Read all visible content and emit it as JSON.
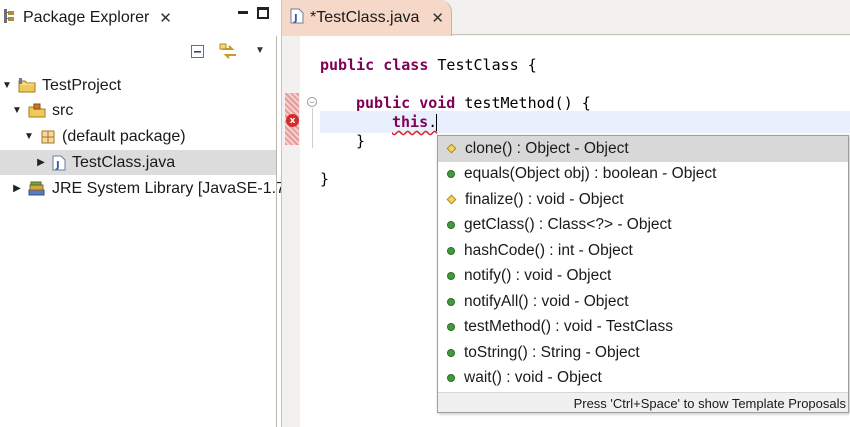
{
  "package_explorer": {
    "title": "Package Explorer",
    "close_glyph": "✕",
    "tree": {
      "project": {
        "label": "TestProject",
        "icon": "project-folder-icon"
      },
      "src": {
        "label": "src",
        "icon": "source-folder-icon"
      },
      "package": {
        "label": "(default package)",
        "icon": "package-icon"
      },
      "file": {
        "label": "TestClass.java",
        "icon": "java-file-icon",
        "selected": true
      },
      "jre": {
        "label": "JRE System Library [JavaSE-1.7",
        "icon": "library-icon"
      }
    }
  },
  "editor": {
    "tab_title": "*TestClass.java",
    "close_glyph": "✕",
    "code": {
      "line1_kw1": "public",
      "line1_kw2": "class",
      "line1_rest": " TestClass {",
      "line2_kw1": "public",
      "line2_kw2": "void",
      "line2_rest": " testMethod() {",
      "line3_kw": "this",
      "line3_rest": ".",
      "line4": "}",
      "line5": "}"
    },
    "error_glyph": "x"
  },
  "content_assist": {
    "proposals": [
      {
        "label": "clone() : Object - Object",
        "icon": "protected-method-icon",
        "selected": true
      },
      {
        "label": "equals(Object obj) : boolean - Object",
        "icon": "public-method-icon"
      },
      {
        "label": "finalize() : void - Object",
        "icon": "protected-method-icon"
      },
      {
        "label": "getClass() : Class<?> - Object",
        "icon": "public-method-icon"
      },
      {
        "label": "hashCode() : int - Object",
        "icon": "public-method-icon"
      },
      {
        "label": "notify() : void - Object",
        "icon": "public-method-icon"
      },
      {
        "label": "notifyAll() : void - Object",
        "icon": "public-method-icon"
      },
      {
        "label": "testMethod() : void - TestClass",
        "icon": "public-method-icon"
      },
      {
        "label": "toString() : String - Object",
        "icon": "public-method-icon"
      },
      {
        "label": "wait() : void - Object",
        "icon": "public-method-icon"
      }
    ],
    "footer": "Press 'Ctrl+Space' to show Template Proposals"
  },
  "colors": {
    "keyword": "#7f0055",
    "active_tab": "#f6d8c9",
    "selection": "#dcdcdc",
    "method_public": "#3e9c3e",
    "method_protected": "#f0d36a",
    "error": "#d62b2b"
  }
}
